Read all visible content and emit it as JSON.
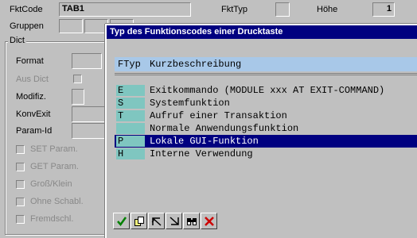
{
  "header": {
    "fktcode_label": "FktCode",
    "fktcode_value": "TAB1",
    "fkttyp_label": "FktTyp",
    "hoehe_label": "Höhe",
    "hoehe_value": "1",
    "gruppen_label": "Gruppen"
  },
  "dict": {
    "title": "Dict",
    "format_label": "Format",
    "aus_dict_label": "Aus Dict",
    "modifiz_label": "Modifiz.",
    "konvexit_label": "KonvExit",
    "param_id_label": "Param-Id",
    "checkboxes": [
      {
        "label": "SET Param."
      },
      {
        "label": "GET Param."
      },
      {
        "label": "Groß/Klein"
      },
      {
        "label": "Ohne Schabl."
      },
      {
        "label": "Fremdschl."
      }
    ]
  },
  "popup": {
    "title": "Typ des Funktionscodes einer Drucktaste",
    "col_ftyp": "FTyp",
    "col_kurz": "Kurzbeschreibung",
    "rows": [
      {
        "code": "E",
        "desc": "Exitkommando (MODULE xxx AT EXIT-COMMAND)"
      },
      {
        "code": "S",
        "desc": "Systemfunktion"
      },
      {
        "code": "T",
        "desc": "Aufruf einer Transaktion"
      },
      {
        "code": "",
        "desc": "Normale Anwendungsfunktion"
      },
      {
        "code": "P",
        "desc": "Lokale GUI-Funktion"
      },
      {
        "code": "H",
        "desc": "Interne Verwendung"
      }
    ],
    "selected_row": 4
  },
  "toolbar": {
    "buttons": [
      "check-icon",
      "copy-icon",
      "move-up-icon",
      "move-down-icon",
      "find-icon",
      "cancel-icon"
    ],
    "accent_green": "#008000",
    "accent_red": "#cc0000"
  }
}
